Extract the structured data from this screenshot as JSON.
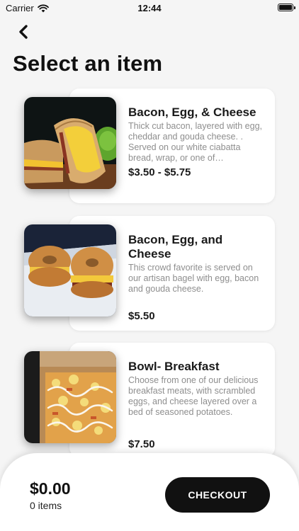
{
  "status_bar": {
    "carrier": "Carrier",
    "time": "12:44",
    "wifi_icon": "wifi-icon",
    "battery_icon": "battery-icon"
  },
  "header": {
    "back_icon": "chevron-left-icon",
    "title": "Select an item"
  },
  "items": [
    {
      "name": "Bacon, Egg, & Cheese",
      "description": "Thick cut bacon, layered with egg, cheddar and gouda cheese. .  Served on our white ciabatta bread, wrap, or one of…",
      "price": "$3.50 - $5.75"
    },
    {
      "name": "Bacon, Egg, and Cheese",
      "description": "This crowd favorite is served on our artisan bagel with egg, bacon and gouda cheese.",
      "price": "$5.50"
    },
    {
      "name": "Bowl- Breakfast",
      "description": "Choose from one of our delicious breakfast meats, with scrambled eggs, and cheese layered over a bed of seasoned potatoes.",
      "price": "$7.50"
    }
  ],
  "cart": {
    "total": "$0.00",
    "count": "0 items",
    "checkout_label": "CHECKOUT"
  },
  "colors": {
    "background": "#f5f5f5",
    "card": "#ffffff",
    "button": "#111111",
    "muted_text": "#8e8e8e"
  }
}
